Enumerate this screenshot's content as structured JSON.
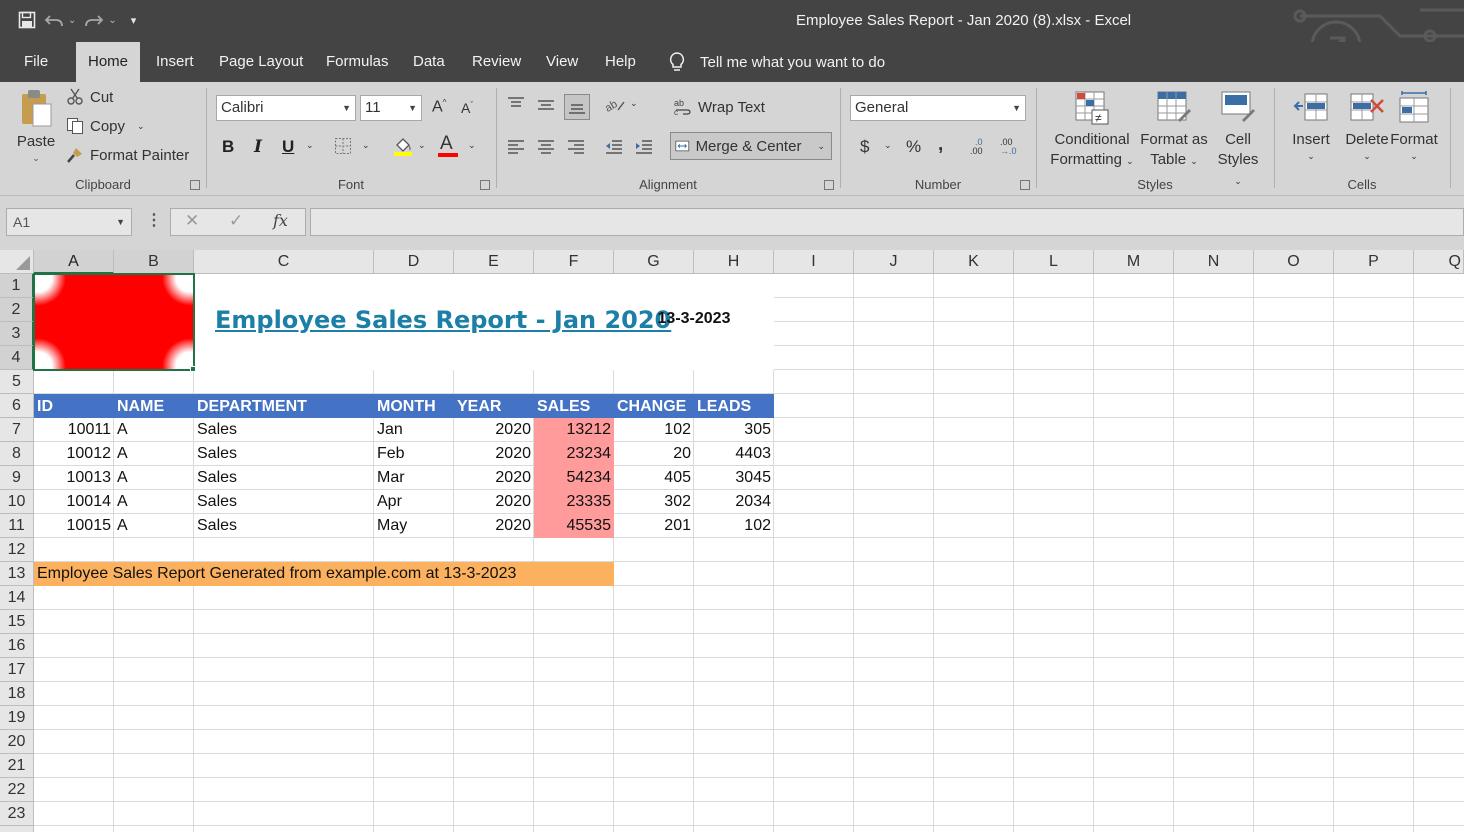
{
  "window": {
    "title": "Employee Sales Report - Jan 2020 (8).xlsx  -  Excel"
  },
  "qat": {
    "save": "save-icon",
    "undo": "undo-icon",
    "redo": "redo-icon",
    "customize": "customize-icon"
  },
  "menu": {
    "tabs": [
      "File",
      "Home",
      "Insert",
      "Page Layout",
      "Formulas",
      "Data",
      "Review",
      "View",
      "Help"
    ],
    "active": "Home",
    "tell_me": "Tell me what you want to do"
  },
  "ribbon": {
    "clipboard": {
      "paste": "Paste",
      "cut": "Cut",
      "copy": "Copy",
      "format_painter": "Format Painter",
      "label": "Clipboard"
    },
    "font": {
      "name": "Calibri",
      "size": "11",
      "bold": "B",
      "italic": "I",
      "underline": "U",
      "grow": "A",
      "shrink": "A",
      "font_color_letter": "A",
      "label": "Font",
      "fill_color": "#ffff00",
      "font_color": "#ff0000"
    },
    "alignment": {
      "wrap_text": "Wrap Text",
      "merge_center": "Merge & Center",
      "label": "Alignment"
    },
    "number": {
      "format": "General",
      "currency": "$",
      "percent": "%",
      "comma": ",",
      "inc_dec": ".0",
      "dec_dec": ".00",
      "label": "Number"
    },
    "styles": {
      "conditional_1": "Conditional",
      "conditional_2": "Formatting",
      "format_table_1": "Format as",
      "format_table_2": "Table",
      "cell_styles_1": "Cell",
      "cell_styles_2": "Styles",
      "label": "Styles"
    },
    "cells": {
      "insert": "Insert",
      "delete": "Delete",
      "format": "Format",
      "label": "Cells"
    }
  },
  "formula_bar": {
    "name_box": "A1",
    "fx": "fx",
    "value": ""
  },
  "grid": {
    "columns": [
      "A",
      "B",
      "C",
      "D",
      "E",
      "F",
      "G",
      "H",
      "I",
      "J",
      "K",
      "L",
      "M",
      "N",
      "O",
      "P",
      "Q"
    ],
    "rows": [
      "1",
      "2",
      "3",
      "4",
      "5",
      "6",
      "7",
      "8",
      "9",
      "10",
      "11",
      "12",
      "13",
      "14",
      "15",
      "16",
      "17",
      "18",
      "19",
      "20",
      "21",
      "22",
      "23"
    ],
    "selected_cell": "A1"
  },
  "report": {
    "title": "Employee Sales Report - Jan 2020",
    "date": "13-3-2023",
    "headers": [
      "ID",
      "NAME",
      "DEPARTMENT",
      "MONTH",
      "YEAR",
      "SALES",
      "CHANGE",
      "LEADS"
    ],
    "rows": [
      [
        "10011",
        "A",
        "Sales",
        "Jan",
        "2020",
        "13212",
        "102",
        "305"
      ],
      [
        "10012",
        "A",
        "Sales",
        "Feb",
        "2020",
        "23234",
        "20",
        "4403"
      ],
      [
        "10013",
        "A",
        "Sales",
        "Mar",
        "2020",
        "54234",
        "405",
        "3045"
      ],
      [
        "10014",
        "A",
        "Sales",
        "Apr",
        "2020",
        "23335",
        "302",
        "2034"
      ],
      [
        "10015",
        "A",
        "Sales",
        "May",
        "2020",
        "45535",
        "201",
        "102"
      ]
    ],
    "footer": "Employee Sales Report Generated from example.com at 13-3-2023",
    "colors": {
      "header_bg": "#4472c4",
      "sales_highlight": "#ff9b9b",
      "footer_bg": "#fbb15e",
      "title_color": "#1b7fa7",
      "logo_red": "#ff0000"
    }
  }
}
